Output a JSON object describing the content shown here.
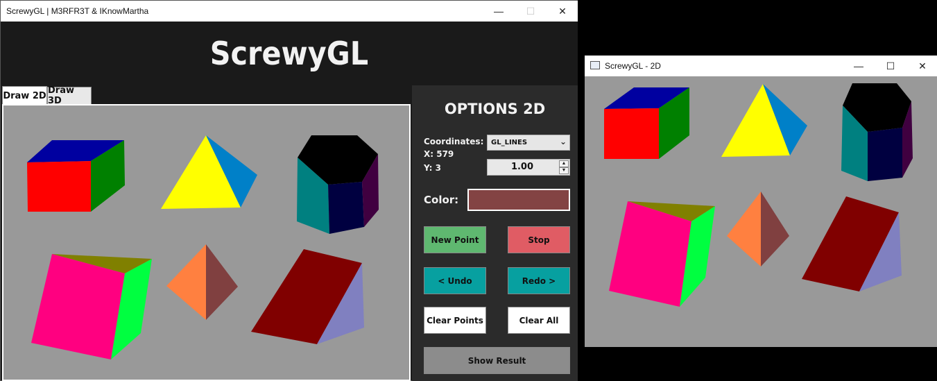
{
  "main_window": {
    "title": "ScrewyGL | M3RFR3T & IKnowMartha",
    "banner_title": "ScrewyGL",
    "tabs": [
      {
        "label": "Draw 2D",
        "active": true
      },
      {
        "label": "Draw 3D",
        "active": false
      }
    ],
    "controls": {
      "minimize": "—",
      "maximize": "☐",
      "close": "✕"
    }
  },
  "options": {
    "title": "OPTIONS 2D",
    "coordinates_label": "Coordinates:",
    "x_label": "X: 579",
    "y_label": "Y: 3",
    "mode_select": {
      "value": "GL_LINES"
    },
    "spinner": {
      "value": "1.00"
    },
    "color_label": "Color:",
    "color_value": "#834343",
    "buttons": {
      "new_point": "New Point",
      "stop": "Stop",
      "undo": "< Undo",
      "redo": "Redo >",
      "clear_points": "Clear Points",
      "clear_all": "Clear All",
      "show_result": "Show Result"
    },
    "button_colors": {
      "new_point": "#5fb870",
      "stop": "#e05c64",
      "undo": "#07a0a0",
      "redo": "#07a0a0",
      "clear": "#ffffff",
      "show_result": "#8c8c8c"
    }
  },
  "result_window": {
    "title": "ScrewyGL - 2D",
    "controls": {
      "minimize": "—",
      "maximize": "☐",
      "close": "✕"
    }
  },
  "colors": {
    "canvas_bg": "#999999",
    "panel_bg": "#2b2b2b",
    "banner_bg": "#1a1a1a"
  }
}
